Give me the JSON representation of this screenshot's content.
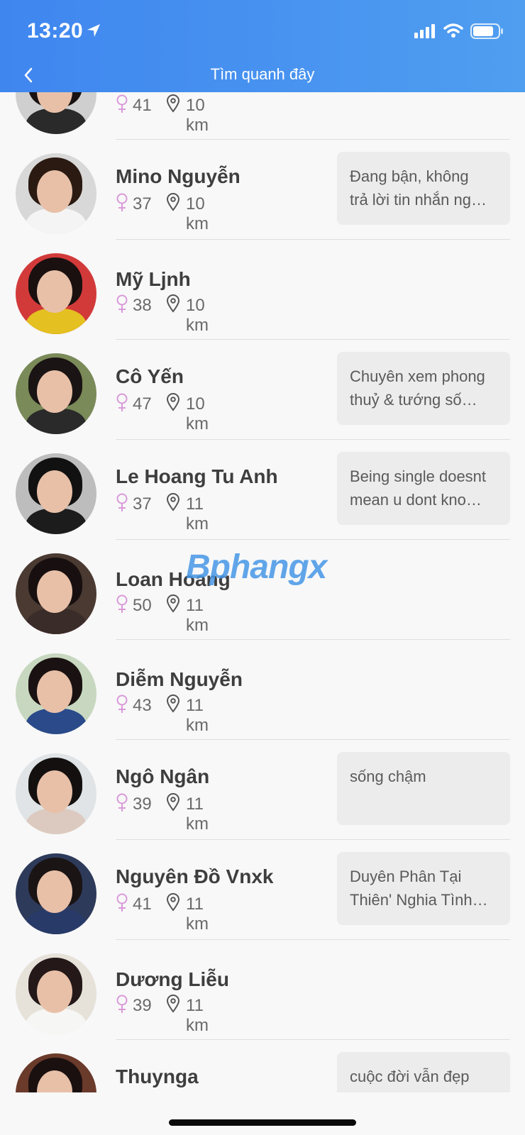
{
  "status_bar": {
    "time": "13:20"
  },
  "header": {
    "title": "Tìm quanh đây"
  },
  "watermark": "Bphangx",
  "people": [
    {
      "name": "",
      "age": "41",
      "distance": "10 km",
      "status": [],
      "colors": {
        "bg": "#cfcfcf",
        "hair": "#1a1212",
        "body": "#2a2a2a"
      }
    },
    {
      "name": "Mino Nguyễn",
      "age": "37",
      "distance": "10 km",
      "status": [
        "Đang bận, không",
        "trả lời tin nhắn ng…"
      ],
      "colors": {
        "bg": "#d8d8d8",
        "hair": "#2a1a12",
        "body": "#f4f4f4"
      }
    },
    {
      "name": "Mỹ Ljnh",
      "age": "38",
      "distance": "10 km",
      "status": [],
      "colors": {
        "bg": "#d23a3a",
        "hair": "#1a1010",
        "body": "#e4c020"
      }
    },
    {
      "name": "Cô Yến",
      "age": "47",
      "distance": "10 km",
      "status": [
        "Chuyên xem phong",
        "thuỷ & tướng số…"
      ],
      "colors": {
        "bg": "#7a8a58",
        "hair": "#1a1414",
        "body": "#2a2a2a"
      }
    },
    {
      "name": "Le Hoang Tu Anh",
      "age": "37",
      "distance": "11 km",
      "status": [
        "Being single doesnt",
        "mean u dont kno…"
      ],
      "colors": {
        "bg": "#bdbdbd",
        "hair": "#111111",
        "body": "#1c1c1c"
      }
    },
    {
      "name": "Loan Hoang",
      "age": "50",
      "distance": "11 km",
      "status": [],
      "colors": {
        "bg": "#4a3a32",
        "hair": "#181010",
        "body": "#3a2c28"
      }
    },
    {
      "name": "Diễm Nguyễn",
      "age": "43",
      "distance": "11 km",
      "status": [],
      "colors": {
        "bg": "#c8d8c0",
        "hair": "#1a1212",
        "body": "#2a4a8a"
      }
    },
    {
      "name": "Ngô Ngân",
      "age": "39",
      "distance": "11 km",
      "status": [
        "sống chậm"
      ],
      "colors": {
        "bg": "#e0e4e6",
        "hair": "#141010",
        "body": "#dccac0"
      }
    },
    {
      "name": "Nguyên Đồ Vnxk",
      "age": "41",
      "distance": "11 km",
      "status": [
        "Duyên Phân Tại",
        "Thiên' Nghia Tình…"
      ],
      "colors": {
        "bg": "#2e3a5a",
        "hair": "#1a1414",
        "body": "#283a68"
      }
    },
    {
      "name": "Dương Liễu",
      "age": "39",
      "distance": "11 km",
      "status": [],
      "colors": {
        "bg": "#e6e2da",
        "hair": "#241818",
        "body": "#f6f6f4"
      }
    },
    {
      "name": "Thuynga",
      "age": "",
      "distance": "",
      "status": [
        "cuộc đời vẫn đẹp"
      ],
      "colors": {
        "bg": "#6a3a2a",
        "hair": "#1a1010",
        "body": "#caa080"
      }
    }
  ]
}
